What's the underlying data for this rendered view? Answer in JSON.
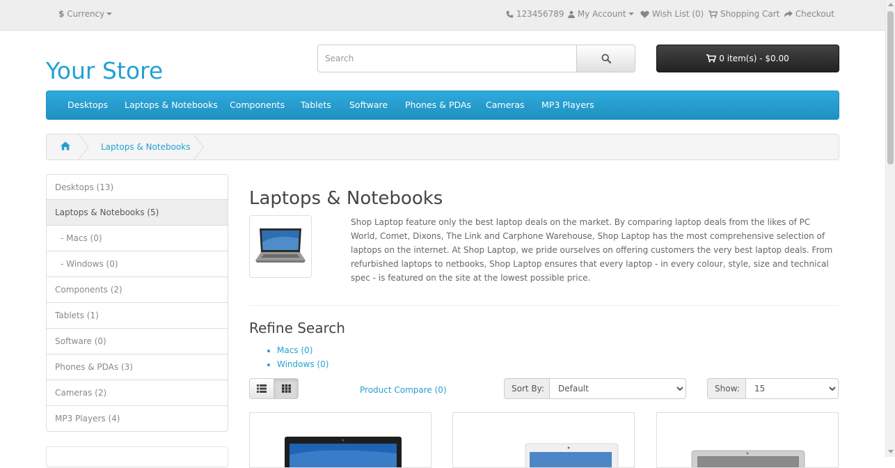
{
  "top_bar": {
    "currency_symbol": "$",
    "currency_label": "Currency",
    "phone": "123456789",
    "my_account": "My Account",
    "wish_list": "Wish List (0)",
    "shopping_cart": "Shopping Cart",
    "checkout": "Checkout"
  },
  "header": {
    "logo": "Your Store",
    "search_placeholder": "Search",
    "cart_summary": "0 item(s) - $0.00"
  },
  "menu": {
    "items": [
      "Desktops",
      "Laptops & Notebooks",
      "Components",
      "Tablets",
      "Software",
      "Phones & PDAs",
      "Cameras",
      "MP3 Players"
    ]
  },
  "breadcrumb": {
    "current": "Laptops & Notebooks"
  },
  "sidebar": {
    "categories": [
      "Desktops (13)",
      "Laptops & Notebooks (5)",
      "- Macs (0)",
      "- Windows (0)",
      "Components (2)",
      "Tablets (1)",
      "Software (0)",
      "Phones & PDAs (3)",
      "Cameras (2)",
      "MP3 Players (4)"
    ]
  },
  "content": {
    "title": "Laptops & Notebooks",
    "description": "Shop Laptop feature only the best laptop deals on the market. By comparing laptop deals from the likes of PC World, Comet, Dixons, The Link and Carphone Warehouse, Shop Laptop has the most comprehensive selection of laptops on the internet. At Shop Laptop, we pride ourselves on offering customers the very best laptop deals. From refurbished laptops to netbooks, Shop Laptop ensures that every laptop - in every colour, style, size and technical spec - is featured on the site at the lowest possible price.",
    "refine_title": "Refine Search",
    "refine_links": [
      "Macs (0)",
      "Windows (0)"
    ],
    "product_compare": "Product Compare (0)",
    "sort_label": "Sort By:",
    "sort_value": "Default",
    "show_label": "Show:",
    "show_value": "15"
  },
  "colors": {
    "link": "#23a1d1",
    "menu_bg": "#229ac8",
    "cart_bg": "#303030"
  }
}
